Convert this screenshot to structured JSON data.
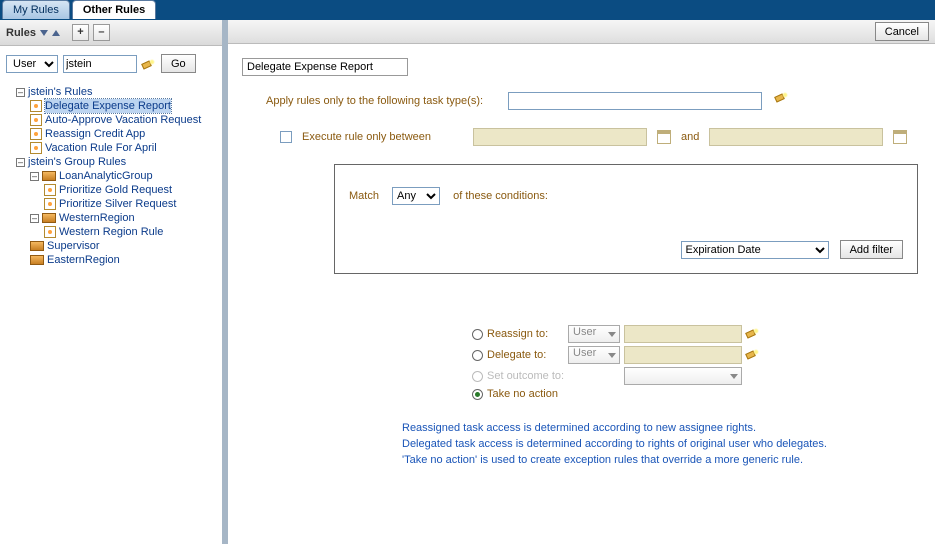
{
  "tabs": {
    "my": "My Rules",
    "other": "Other Rules"
  },
  "rules_header": "Rules",
  "plus": "+",
  "minus": "–",
  "scope_select": {
    "value": "User"
  },
  "scope_user": "jstein",
  "go": "Go",
  "tree": {
    "root1": "jstein's Rules",
    "r1": "Delegate Expense Report",
    "r2": "Auto-Approve Vacation Request",
    "r3": "Reassign Credit App",
    "r4": "Vacation Rule For April",
    "root2": "jstein's Group Rules",
    "g1": "LoanAnalyticGroup",
    "g1a": "Prioritize Gold Request",
    "g1b": "Prioritize Silver Request",
    "g2": "WesternRegion",
    "g2a": "Western Region Rule",
    "g3": "Supervisor",
    "g4": "EasternRegion"
  },
  "cancel": "Cancel",
  "rule_name": "Delegate Expense Report",
  "apply_label": "Apply rules only to the following task type(s):",
  "apply_value": "",
  "exec_label": "Execute rule only between",
  "and": "and",
  "match": "Match",
  "match_mode": "Any",
  "match_tail": "of these conditions:",
  "filter_field": "Expiration Date",
  "add_filter": "Add filter",
  "act": {
    "reassign": "Reassign to:",
    "delegate": "Delegate to:",
    "outcome": "Set outcome to:",
    "none": "Take no action",
    "user": "User"
  },
  "help1": "Reassigned task access is determined according to new assignee rights.",
  "help2": "Delegated task access is determined according to rights of original user who delegates.",
  "help3": "'Take no action' is used to create exception rules that override a more generic rule."
}
